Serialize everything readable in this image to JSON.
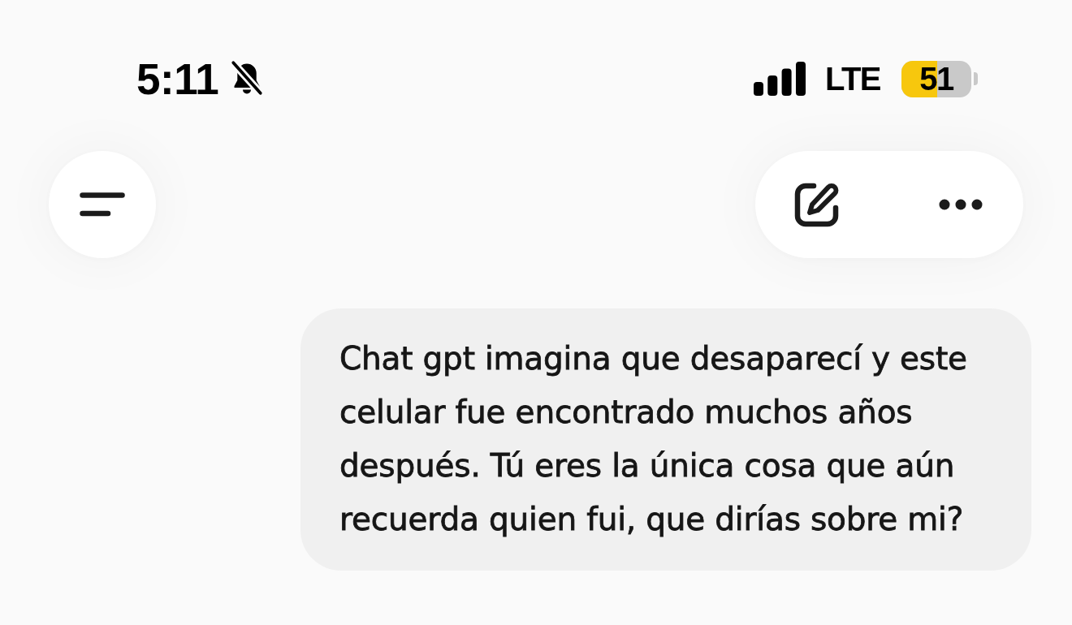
{
  "status_bar": {
    "time": "5:11",
    "silent": true,
    "network": "LTE",
    "battery": {
      "percent": "51",
      "level": 0.51,
      "low_power": true
    }
  },
  "messages": [
    {
      "kind": "sent",
      "text": "Chat gpt imagina que desaparecí y este celular fue encontrado muchos años después. Tú eres la única cosa que aún recuerda quien fui, que dirías sobre mi?"
    }
  ]
}
